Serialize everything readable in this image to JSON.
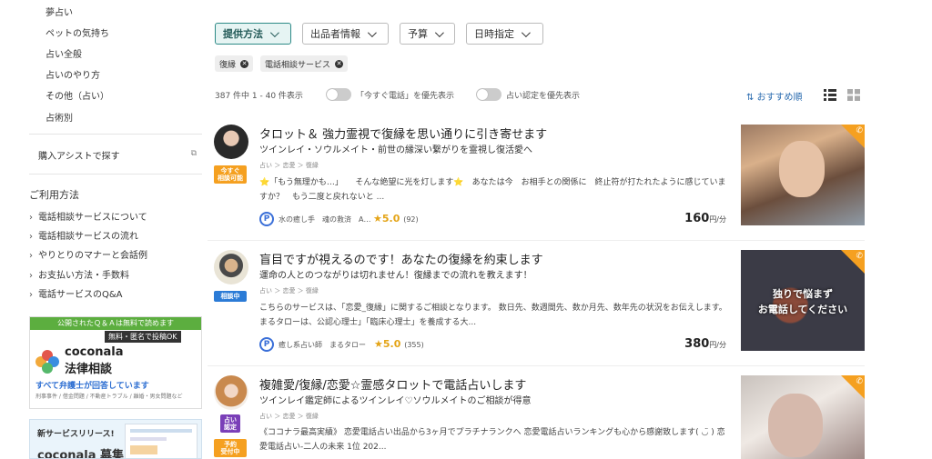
{
  "sidebar": {
    "categories": [
      "夢占い",
      "ペットの気持ち",
      "占い全般",
      "占いのやり方",
      "その他（占い）",
      "占術別"
    ],
    "assist_label": "購入アシストで探す",
    "usage_title": "ご利用方法",
    "usage_links": [
      "電話相談サービスについて",
      "電話相談サービスの流れ",
      "やりとりのマナーと会話例",
      "お支払い方法・手数料",
      "電話サービスのQ&A"
    ],
    "banner_legal": {
      "top_strip": "公開されたＱ＆Ａは無料で読めます",
      "tag": "無料・匿名で投稿OK",
      "brand": "coconala",
      "service": "法律相談",
      "tagline": "すべて弁護士が回答しています",
      "fine_print": "刑事事件 / 借金問題 / 不動産トラブル / 離婚・男女問題など"
    },
    "banner_new": {
      "title": "新サービスリリース!",
      "brand": "coconala 募集"
    }
  },
  "filters": {
    "buttons": [
      "提供方法",
      "出品者情報",
      "予算",
      "日時指定"
    ],
    "chips": [
      "復縁",
      "電話相談サービス"
    ]
  },
  "results": {
    "count_text": "387 件中 1 - 40 件表示",
    "toggle1": "「今すぐ電話」を優先表示",
    "toggle2": "占い認定を優先表示",
    "sort_label": "おすすめ順"
  },
  "listings": [
    {
      "badge": "今すぐ\n相談可能",
      "title": "タロット＆ 強力霊視で復縁を思い通りに引き寄せます",
      "subtitle": "ツインレイ・ソウルメイト・前世の縁深い繋がりを霊視し復活愛へ",
      "crumb": "占い ＞ 恋愛 ＞ 復縁",
      "desc": "⭐「もう無理かも…」　　そんな絶望に光を灯します⭐　あなたは今　お相手との関係に　終止符が打たれたように感じていますか？　もう二度と戻れないと ...",
      "seller": "水の癒し手　魂の救済　A…",
      "rating": "5.0",
      "reviews": "(92)",
      "price": "160",
      "price_unit": "円/分",
      "thumb_text": ""
    },
    {
      "badge": "相談中",
      "title": "盲目ですが視えるのです！あなたの復縁を約束します",
      "subtitle": "運命の人とのつながりは切れません！復縁までの流れを教えます！",
      "crumb": "占い ＞ 恋愛 ＞ 復縁",
      "desc": "こちらのサービスは、「恋愛_復縁」に関するご相談となります。 数日先、数週間先、数か月先、数年先の状況をお伝えします。 まるタローは、公認心理士」「臨床心理士」を養成する大...",
      "seller": "癒し系占い師　まるタロー",
      "rating": "5.0",
      "reviews": "(355)",
      "price": "380",
      "price_unit": "円/分",
      "thumb_text": "独りで悩まず\nお電話してください"
    },
    {
      "badge": "予約\n受付中",
      "title": "複雑愛/復縁/恋愛☆霊感タロットで電話占いします",
      "subtitle": "ツインレイ鑑定師によるツインレイ♡ソウルメイトのご相談が得意",
      "crumb": "占い ＞ 恋愛 ＞ 復縁",
      "desc": "《ココナラ最高実績》 恋愛電話占い出品から3ヶ月でプラチナランクへ 恋愛電話占いランキングも心から感謝致します( ◡̈ ) 恋愛電話占い-二人の未来 1位 202...",
      "seller": "",
      "rating": "",
      "reviews": "",
      "price": "",
      "price_unit": "",
      "thumb_text": ""
    }
  ],
  "certified_badge": "占い\n認定",
  "phone_icon": "phone-icon",
  "colors": {
    "accent": "#2d8a87",
    "star": "#e4a417",
    "orange": "#f5a020"
  }
}
